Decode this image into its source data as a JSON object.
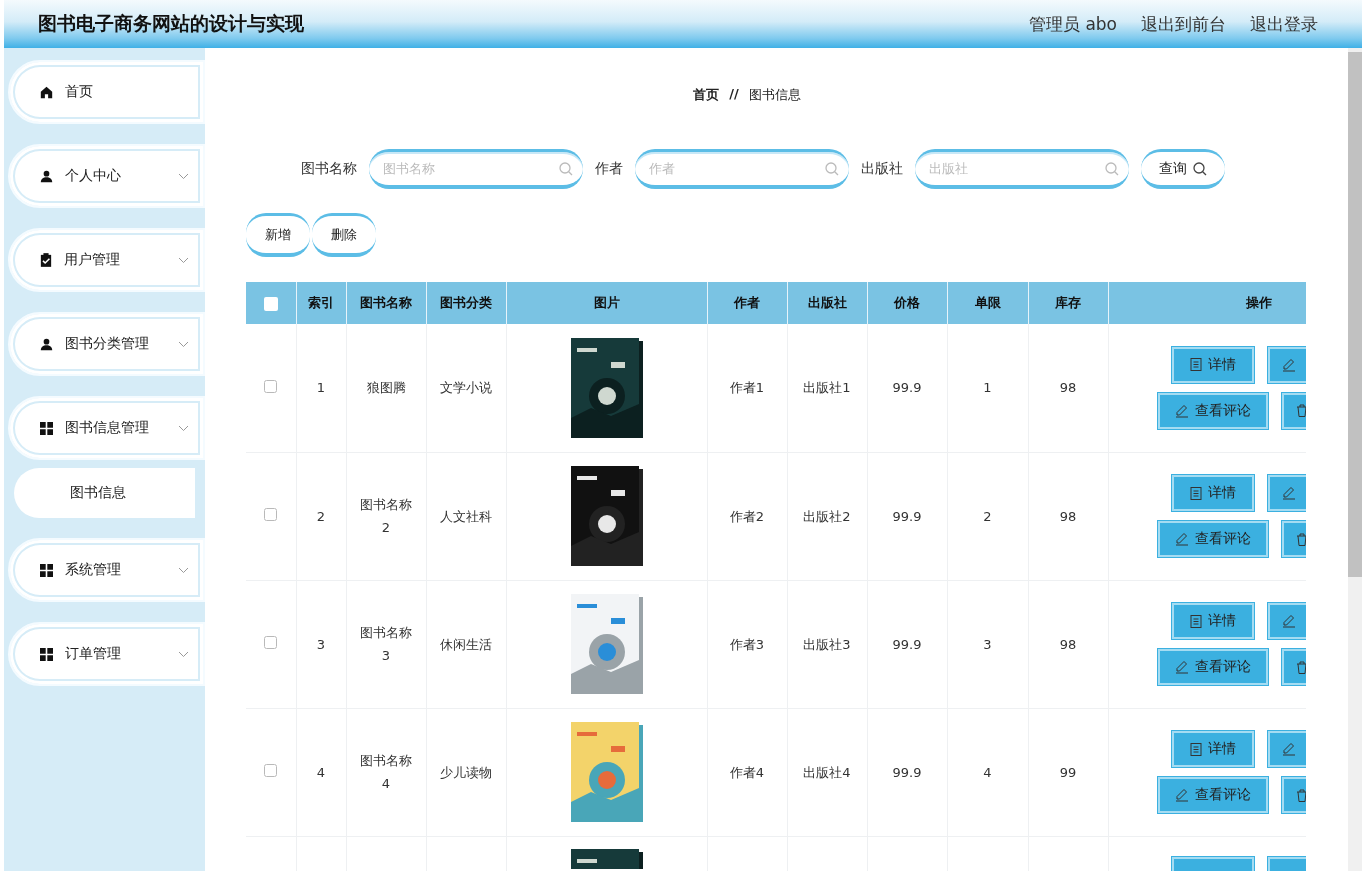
{
  "header": {
    "title": "图书电子商务网站的设计与实现",
    "links": [
      "管理员 abo",
      "退出到前台",
      "退出登录"
    ]
  },
  "sidebar": {
    "items": [
      {
        "kind": "link",
        "label": "首页",
        "selected": false
      },
      {
        "kind": "menu",
        "label": "个人中心",
        "selected": false
      },
      {
        "kind": "menu",
        "label": "用户管理",
        "selected": false
      },
      {
        "kind": "menu",
        "label": "图书分类管理",
        "selected": false
      },
      {
        "kind": "menu",
        "label": "图书信息管理",
        "selected": false,
        "children": [
          {
            "label": "图书信息",
            "selected": true
          }
        ]
      },
      {
        "kind": "menu",
        "label": "系统管理",
        "selected": false
      },
      {
        "kind": "menu",
        "label": "订单管理",
        "selected": false
      }
    ]
  },
  "breadcrumb": [
    "首页",
    "//",
    "图书信息"
  ],
  "search": {
    "fields": [
      {
        "label": "图书名称",
        "placeholder": "图书名称"
      },
      {
        "label": "作者",
        "placeholder": "作者"
      },
      {
        "label": "出版社",
        "placeholder": "出版社"
      }
    ],
    "button": "查询"
  },
  "actions": [
    "新增",
    "删除"
  ],
  "table": {
    "select_all": {
      "checked": false
    },
    "columns": [
      "索引",
      "图书名称",
      "图书分类",
      "图片",
      "作者",
      "出版社",
      "价格",
      "单限",
      "库存",
      "操作"
    ],
    "rows": [
      {
        "kind": "full",
        "checked": false,
        "cells": [
          "1",
          "狼图腾",
          "文学小说",
          "作者1",
          "出版社1",
          "99.9",
          "1",
          "98"
        ],
        "buttons": [
          {
            "kind": "detail",
            "label": "详情"
          },
          {
            "kind": "edit"
          },
          {
            "kind": "comments",
            "label": "查看评论"
          },
          {
            "kind": "delete"
          }
        ]
      },
      {
        "kind": "full",
        "checked": false,
        "cells": [
          "2",
          "图书名称2",
          "人文社科",
          "作者2",
          "出版社2",
          "99.9",
          "2",
          "98"
        ],
        "buttons": [
          {
            "kind": "detail",
            "label": "详情"
          },
          {
            "kind": "edit"
          },
          {
            "kind": "comments",
            "label": "查看评论"
          },
          {
            "kind": "delete"
          }
        ]
      },
      {
        "kind": "full",
        "checked": false,
        "cells": [
          "3",
          "图书名称3",
          "休闲生活",
          "作者3",
          "出版社3",
          "99.9",
          "3",
          "98"
        ],
        "buttons": [
          {
            "kind": "detail",
            "label": "详情"
          },
          {
            "kind": "edit"
          },
          {
            "kind": "comments",
            "label": "查看评论"
          },
          {
            "kind": "delete"
          }
        ]
      },
      {
        "kind": "full",
        "checked": false,
        "cells": [
          "4",
          "图书名称4",
          "少儿读物",
          "作者4",
          "出版社4",
          "99.9",
          "4",
          "99"
        ],
        "buttons": [
          {
            "kind": "detail",
            "label": "详情"
          },
          {
            "kind": "edit"
          },
          {
            "kind": "comments",
            "label": "查看评论"
          },
          {
            "kind": "delete"
          }
        ]
      },
      {
        "kind": "partial"
      }
    ]
  }
}
